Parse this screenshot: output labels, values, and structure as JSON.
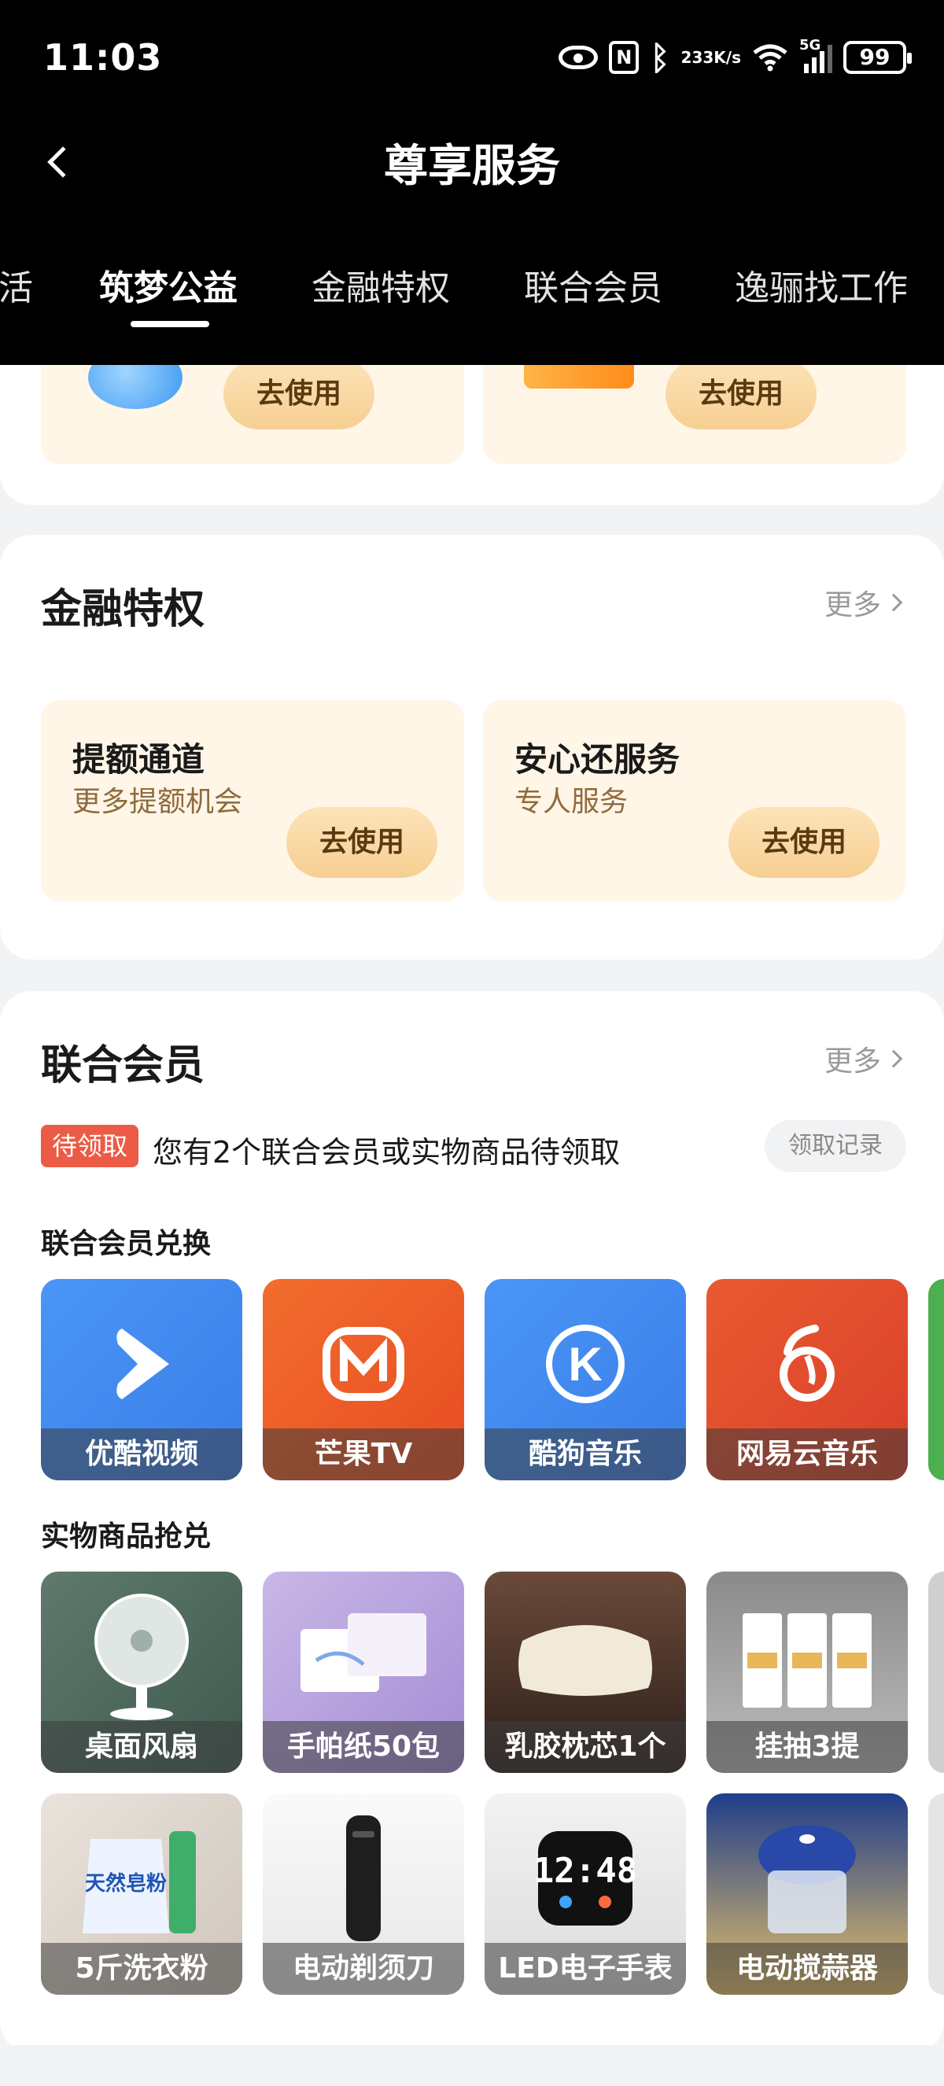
{
  "status": {
    "time": "11:03",
    "net_speed_top": "233",
    "net_speed_bottom": "K/s",
    "network_label": "5G",
    "battery": "99"
  },
  "header": {
    "title": "尊享服务"
  },
  "tabs": [
    {
      "label": "活"
    },
    {
      "label": "筑梦公益"
    },
    {
      "label": "金融特权"
    },
    {
      "label": "联合会员"
    },
    {
      "label": "逸骊找工作"
    }
  ],
  "top_card": {
    "use_label": "去使用"
  },
  "finance": {
    "title": "金融特权",
    "more": "更多",
    "services": [
      {
        "name": "提额通道",
        "desc": "更多提额机会",
        "button": "去使用"
      },
      {
        "name": "安心还服务",
        "desc": "专人服务",
        "button": "去使用"
      }
    ]
  },
  "membership": {
    "title": "联合会员",
    "more": "更多",
    "pending_badge": "待领取",
    "pending_text": "您有2个联合会员或实物商品待领取",
    "records_button": "领取记录",
    "exchange_title": "联合会员兑换",
    "exchange_items": [
      {
        "label": "优酷视频",
        "icon": "youku-icon",
        "color": "#3f8cf2"
      },
      {
        "label": "芒果TV",
        "icon": "mango-tv-icon",
        "color": "#ef5a2a"
      },
      {
        "label": "酷狗音乐",
        "icon": "kugou-icon",
        "color": "#3f8cf2"
      },
      {
        "label": "网易云音乐",
        "icon": "netease-music-icon",
        "color": "#e34b2a"
      }
    ],
    "goods_title": "实物商品抢兑",
    "goods_row1": [
      {
        "label": "桌面风扇",
        "icon": "desk-fan-icon"
      },
      {
        "label": "手帕纸50包",
        "icon": "tissue-pack-icon"
      },
      {
        "label": "乳胶枕芯1个",
        "icon": "pillow-icon"
      },
      {
        "label": "挂抽3提",
        "icon": "hanging-tissue-icon"
      }
    ],
    "goods_row2": [
      {
        "label": "5斤洗衣粉",
        "icon": "detergent-icon"
      },
      {
        "label": "电动剃须刀",
        "icon": "shaver-icon"
      },
      {
        "label": "LED电子手表",
        "icon": "led-watch-icon"
      },
      {
        "label": "电动搅蒜器",
        "icon": "garlic-chopper-icon"
      }
    ]
  }
}
